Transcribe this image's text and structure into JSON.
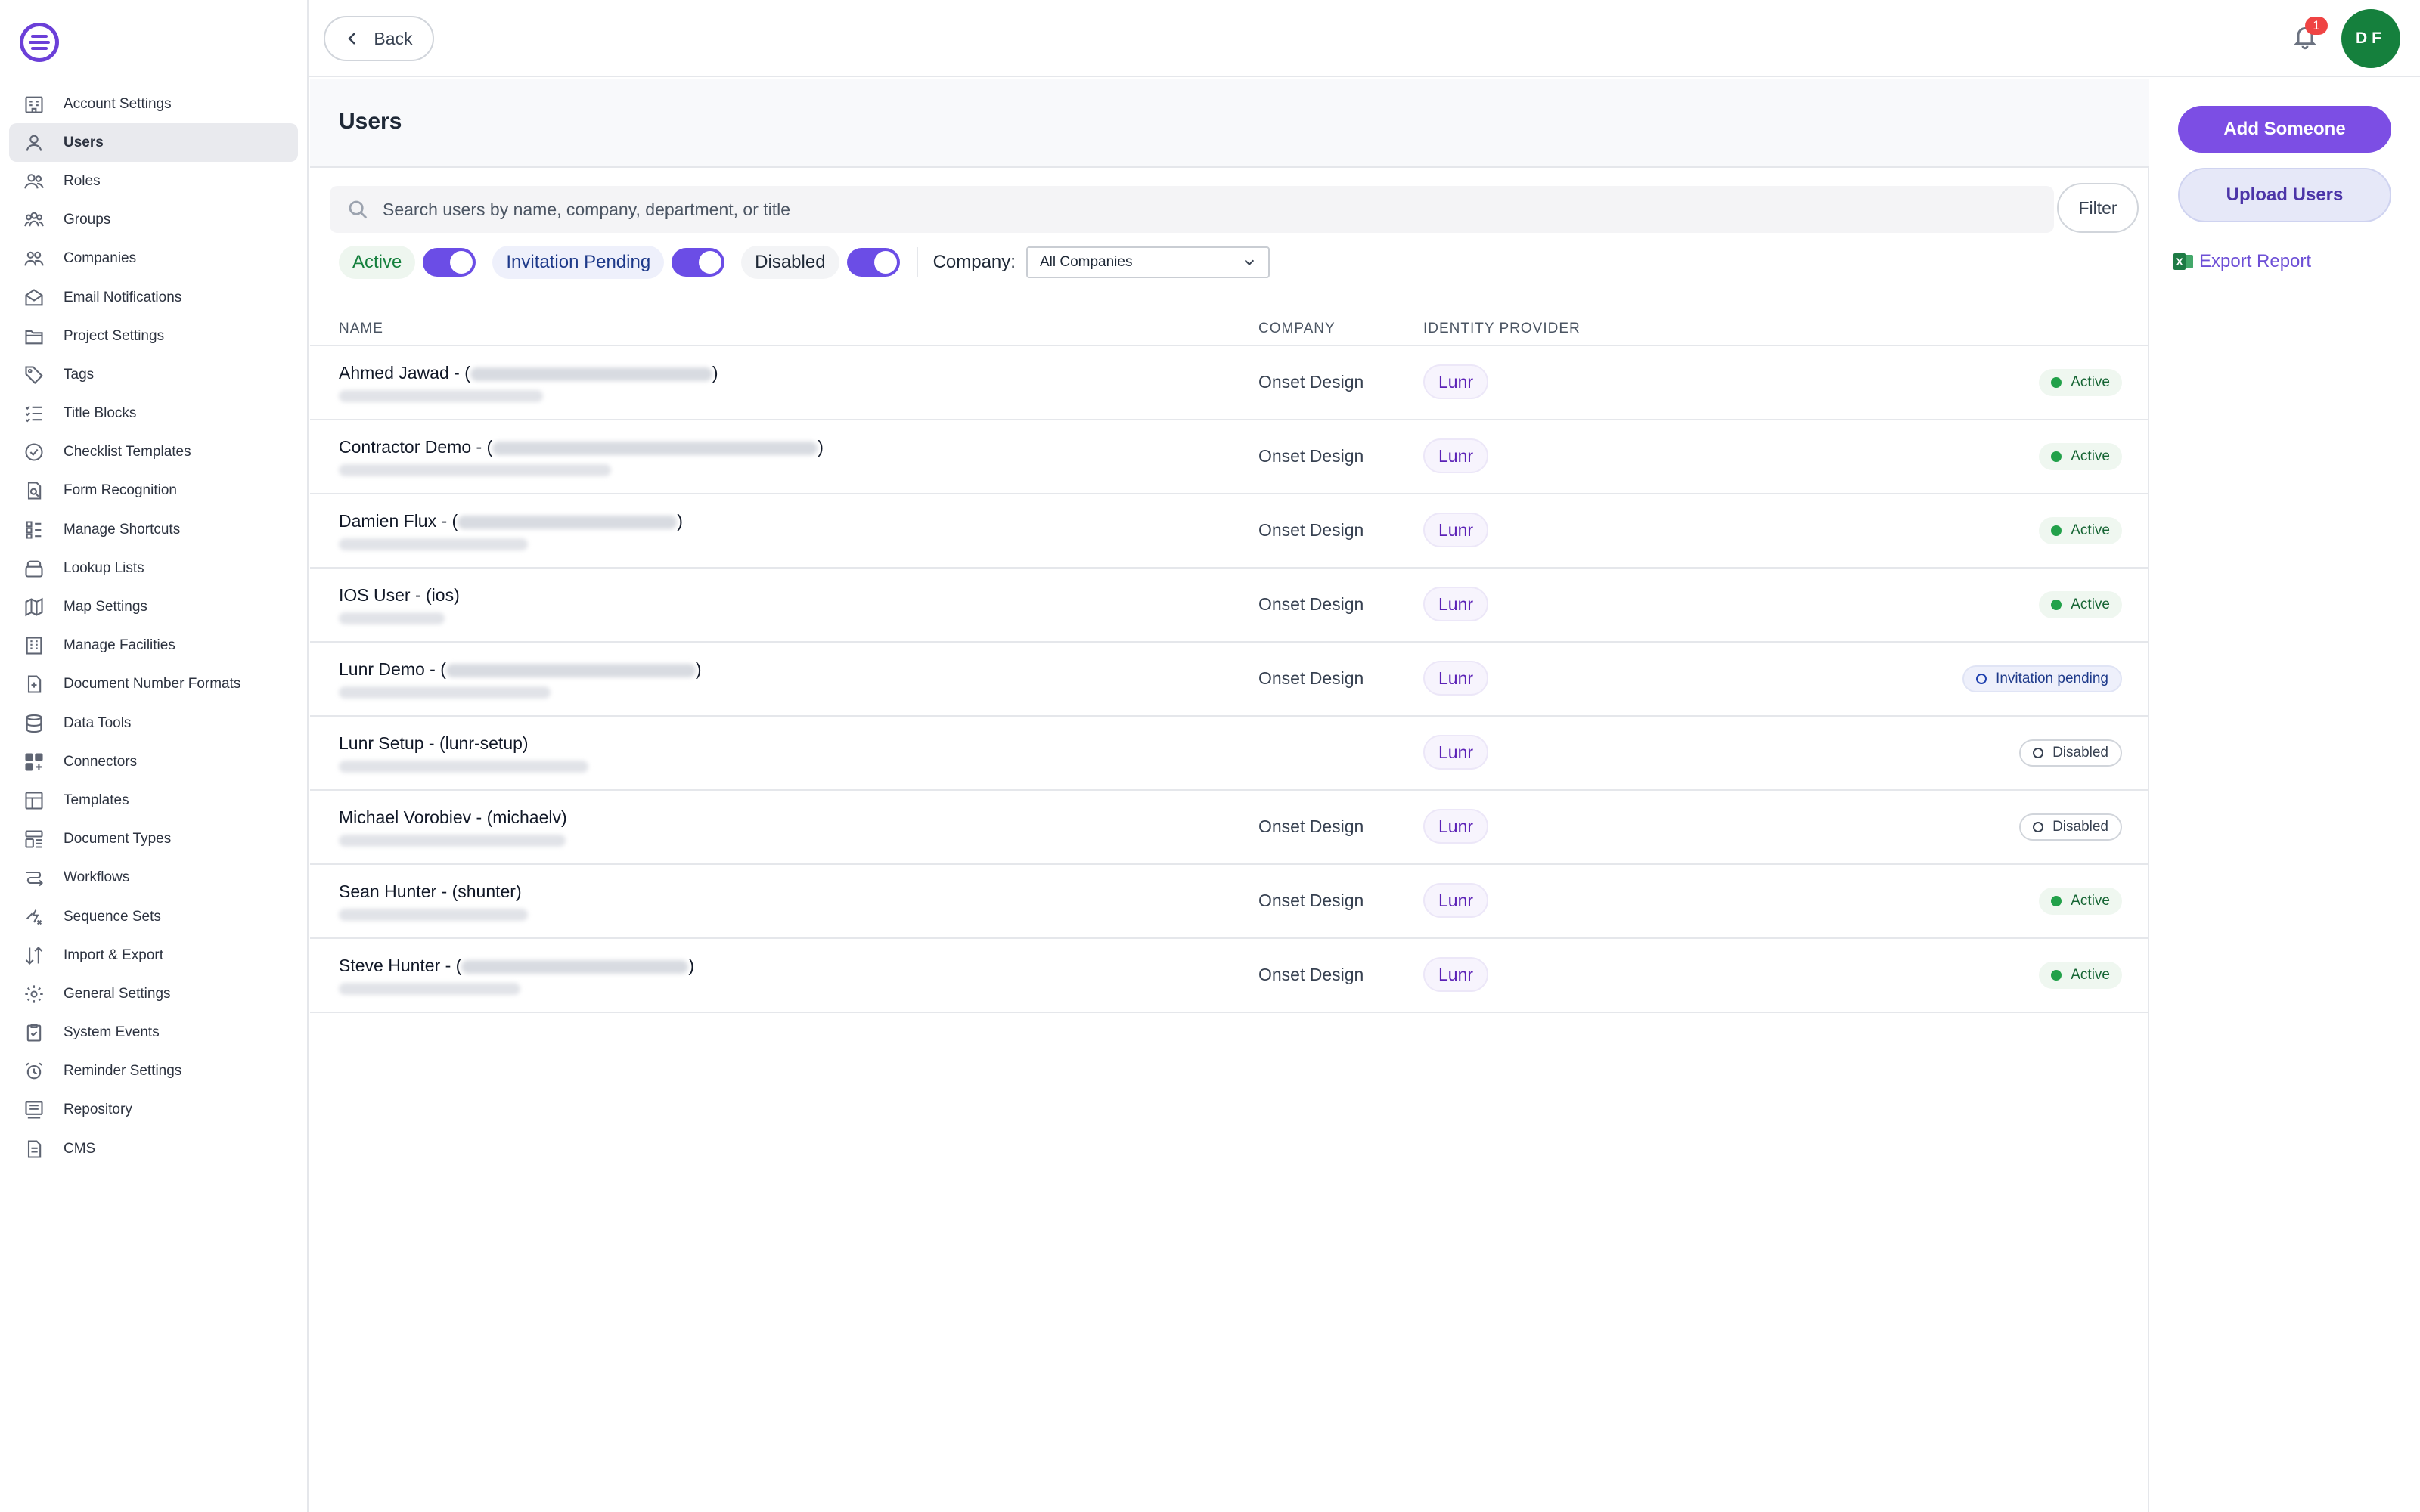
{
  "sidebar": {
    "items": [
      {
        "label": "Account Settings",
        "icon": "building-icon"
      },
      {
        "label": "Users",
        "icon": "user-icon",
        "active": true
      },
      {
        "label": "Roles",
        "icon": "users-icon"
      },
      {
        "label": "Groups",
        "icon": "group-icon"
      },
      {
        "label": "Companies",
        "icon": "company-icon"
      },
      {
        "label": "Email Notifications",
        "icon": "envelope-icon"
      },
      {
        "label": "Project Settings",
        "icon": "folder-icon"
      },
      {
        "label": "Tags",
        "icon": "tag-icon"
      },
      {
        "label": "Title Blocks",
        "icon": "checklist-icon"
      },
      {
        "label": "Checklist Templates",
        "icon": "check-circle-icon"
      },
      {
        "label": "Form Recognition",
        "icon": "doc-search-icon"
      },
      {
        "label": "Manage Shortcuts",
        "icon": "shortcuts-icon"
      },
      {
        "label": "Lookup Lists",
        "icon": "stack-icon"
      },
      {
        "label": "Map Settings",
        "icon": "map-icon"
      },
      {
        "label": "Manage Facilities",
        "icon": "facility-icon"
      },
      {
        "label": "Document Number Formats",
        "icon": "doc-plus-icon"
      },
      {
        "label": "Data Tools",
        "icon": "database-icon"
      },
      {
        "label": "Connectors",
        "icon": "connectors-icon"
      },
      {
        "label": "Templates",
        "icon": "template-icon"
      },
      {
        "label": "Document Types",
        "icon": "doc-types-icon"
      },
      {
        "label": "Workflows",
        "icon": "workflow-icon"
      },
      {
        "label": "Sequence Sets",
        "icon": "sequence-icon"
      },
      {
        "label": "Import & Export",
        "icon": "import-export-icon"
      },
      {
        "label": "General Settings",
        "icon": "gear-icon"
      },
      {
        "label": "System Events",
        "icon": "clipboard-check-icon"
      },
      {
        "label": "Reminder Settings",
        "icon": "alarm-icon"
      },
      {
        "label": "Repository",
        "icon": "repository-icon"
      },
      {
        "label": "CMS",
        "icon": "file-icon"
      }
    ]
  },
  "topbar": {
    "back_label": "Back",
    "notification_count": "1",
    "avatar_initials": "DF"
  },
  "page": {
    "title": "Users"
  },
  "search": {
    "placeholder": "Search users by name, company, department, or title",
    "filter_label": "Filter"
  },
  "filters": {
    "active_label": "Active",
    "pending_label": "Invitation Pending",
    "disabled_label": "Disabled",
    "company_label": "Company:",
    "company_value": "All Companies"
  },
  "table": {
    "headers": {
      "name": "NAME",
      "company": "COMPANY",
      "idp": "IDENTITY PROVIDER"
    },
    "rows": [
      {
        "name": "Ahmed Jawad - (",
        "close": ")",
        "company": "Onset Design",
        "idp": "Lunr",
        "status": "Active",
        "kind": "active"
      },
      {
        "name": "Contractor Demo - (",
        "close": ")",
        "company": "Onset Design",
        "idp": "Lunr",
        "status": "Active",
        "kind": "active"
      },
      {
        "name": "Damien Flux - (",
        "close": ")",
        "company": "Onset Design",
        "idp": "Lunr",
        "status": "Active",
        "kind": "active"
      },
      {
        "name": "IOS User - (ios)",
        "close": "",
        "company": "Onset Design",
        "idp": "Lunr",
        "status": "Active",
        "kind": "active"
      },
      {
        "name": "Lunr Demo - (",
        "close": ")",
        "company": "Onset Design",
        "idp": "Lunr",
        "status": "Invitation pending",
        "kind": "pending"
      },
      {
        "name": "Lunr Setup - (lunr-setup)",
        "close": "",
        "company": "",
        "idp": "Lunr",
        "status": "Disabled",
        "kind": "disabled"
      },
      {
        "name": "Michael Vorobiev - (michaelv)",
        "close": "",
        "company": "Onset Design",
        "idp": "Lunr",
        "status": "Disabled",
        "kind": "disabled"
      },
      {
        "name": "Sean Hunter - (shunter)",
        "close": "",
        "company": "Onset Design",
        "idp": "Lunr",
        "status": "Active",
        "kind": "active"
      },
      {
        "name": "Steve Hunter - (",
        "close": ")",
        "company": "Onset Design",
        "idp": "Lunr",
        "status": "Active",
        "kind": "active"
      }
    ]
  },
  "actions": {
    "add_label": "Add Someone",
    "upload_label": "Upload Users",
    "export_label": "Export Report"
  },
  "colors": {
    "accent": "#7c4ee4",
    "active_status": "#22a14a",
    "avatar": "#15803d",
    "badge": "#ef4444"
  }
}
